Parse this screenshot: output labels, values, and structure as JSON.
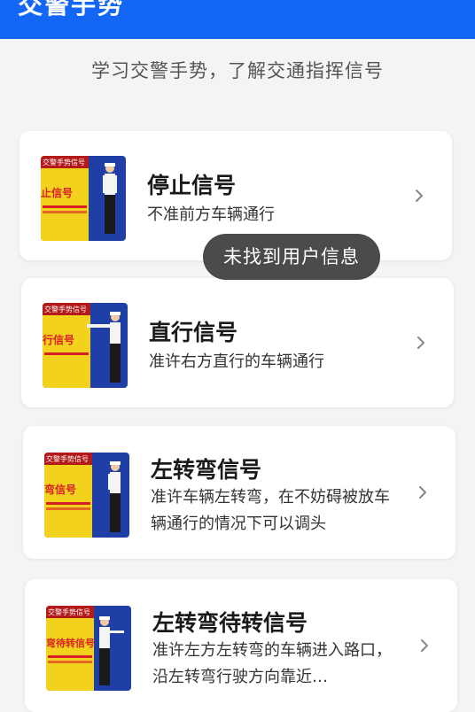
{
  "header": {
    "title": "交警手势"
  },
  "subtitle": "学习交警手势，了解交通指挥信号",
  "cards": [
    {
      "thumb_banner": "交警手势信号",
      "thumb_label": "止信号",
      "title": "停止信号",
      "desc": "不准前方车辆通行"
    },
    {
      "thumb_banner": "交警手势信号",
      "thumb_label": "行信号",
      "title": "直行信号",
      "desc": "准许右方直行的车辆通行"
    },
    {
      "thumb_banner": "交警手势信号",
      "thumb_label": "弯信号",
      "title": "左转弯信号",
      "desc": "准许车辆左转弯，在不妨碍被放车辆通行的情况下可以调头"
    },
    {
      "thumb_banner": "交警手势信号",
      "thumb_label": "弯待转信号",
      "title": "左转弯待转信号",
      "desc": "准许左方左转弯的车辆进入路口，沿左转弯行驶方向靠近…"
    }
  ],
  "toast": "未找到用户信息",
  "colors": {
    "header_bg": "#1466f5",
    "page_bg": "#f3f4f6",
    "thumb_blue": "#1f3fa6",
    "thumb_yellow": "#f2d21c",
    "thumb_red": "#d81f26"
  },
  "icons": {
    "chevron": "chevron-right-icon"
  }
}
